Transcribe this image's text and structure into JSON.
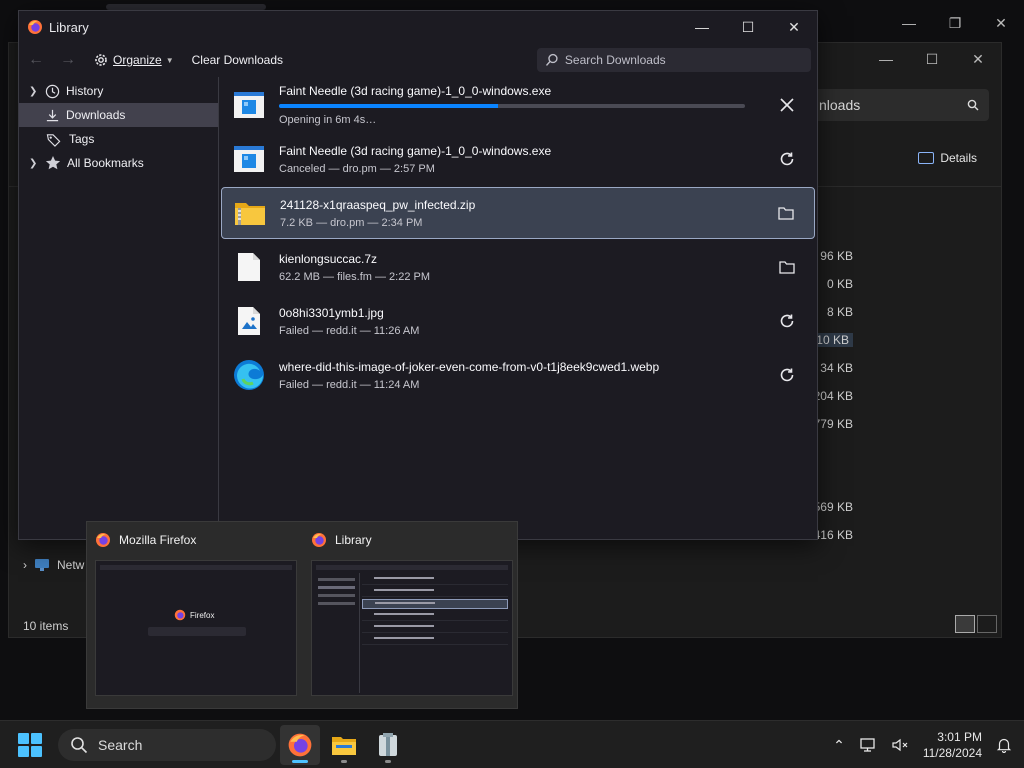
{
  "background_explorer": {
    "search_text": "nloads",
    "details_label": "Details",
    "sizes": [
      "96 KB",
      "0 KB",
      "8 KB",
      "710 KB",
      "34 KB",
      "204 KB",
      "779 KB",
      "569 KB",
      "416 KB"
    ],
    "network_label": "Netw",
    "item_count": "10 items"
  },
  "library": {
    "title": "Library",
    "toolbar": {
      "organize_label": "Organize",
      "clear_label": "Clear Downloads",
      "search_placeholder": "Search Downloads"
    },
    "sidebar": [
      {
        "label": "History",
        "icon": "clock-icon"
      },
      {
        "label": "Downloads",
        "icon": "download-icon"
      },
      {
        "label": "Tags",
        "icon": "tag-icon"
      },
      {
        "label": "All Bookmarks",
        "icon": "star-icon"
      }
    ],
    "downloads": [
      {
        "name": "Faint Needle (3d racing game)-1_0_0-windows.exe",
        "status": "Opening in 6m 4s…",
        "progress": 0.47,
        "icon": "installer-icon",
        "action": "cancel-icon"
      },
      {
        "name": "Faint Needle (3d racing game)-1_0_0-windows.exe",
        "status": "Canceled — dro.pm — 2:57 PM",
        "icon": "installer-icon",
        "action": "retry-icon"
      },
      {
        "name": "241128-x1qraaspeq_pw_infected.zip",
        "status": "7.2 KB — dro.pm — 2:34 PM",
        "icon": "zip-folder-icon",
        "action": "folder-icon"
      },
      {
        "name": "kienlongsuccac.7z",
        "status": "62.2 MB — files.fm — 2:22 PM",
        "icon": "file-icon",
        "action": "folder-icon"
      },
      {
        "name": "0o8hi3301ymb1.jpg",
        "status": "Failed — redd.it — 11:26 AM",
        "icon": "image-file-icon",
        "action": "retry-icon"
      },
      {
        "name": "where-did-this-image-of-joker-even-come-from-v0-t1j8eek9cwed1.webp",
        "status": "Failed — redd.it — 11:24 AM",
        "icon": "edge-icon",
        "action": "retry-icon"
      }
    ]
  },
  "thumbnails": [
    {
      "title": "Mozilla Firefox",
      "preview_brand": "Firefox"
    },
    {
      "title": "Library"
    }
  ],
  "taskbar": {
    "search_label": "Search",
    "time": "3:01 PM",
    "date": "11/28/2024"
  },
  "colors": {
    "accent": "#0a84ff",
    "selection": "#3b4251",
    "windows_blue": "#4cc2ff"
  }
}
